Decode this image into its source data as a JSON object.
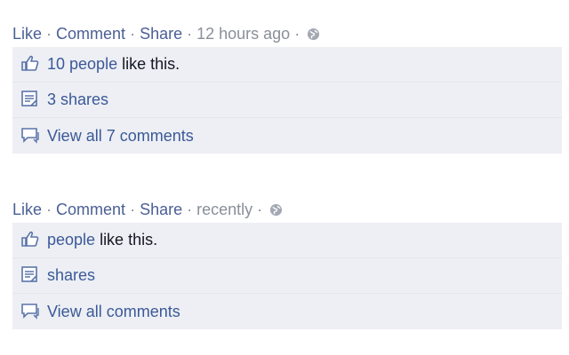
{
  "posts": [
    {
      "actions": {
        "like": "Like",
        "comment": "Comment",
        "share": "Share",
        "time": "12 hours ago"
      },
      "likes": {
        "link": "10 people",
        "text": " like this."
      },
      "shares": {
        "link": "3 shares"
      },
      "comments": {
        "link": "View all 7 comments"
      }
    },
    {
      "actions": {
        "like": "Like",
        "comment": "Comment",
        "share": "Share",
        "time": "recently"
      },
      "likes": {
        "link": "people",
        "text": " like this."
      },
      "shares": {
        "link": "shares"
      },
      "comments": {
        "link": "View all comments"
      }
    }
  ],
  "separator": " · ",
  "colors": {
    "link": "#4b5f94",
    "box": "#edeff4",
    "meta": "#8a8f99"
  },
  "icons": {
    "globe": "globe-icon",
    "like": "thumbs-up-icon",
    "share": "share-icon",
    "comment": "comment-icon"
  }
}
